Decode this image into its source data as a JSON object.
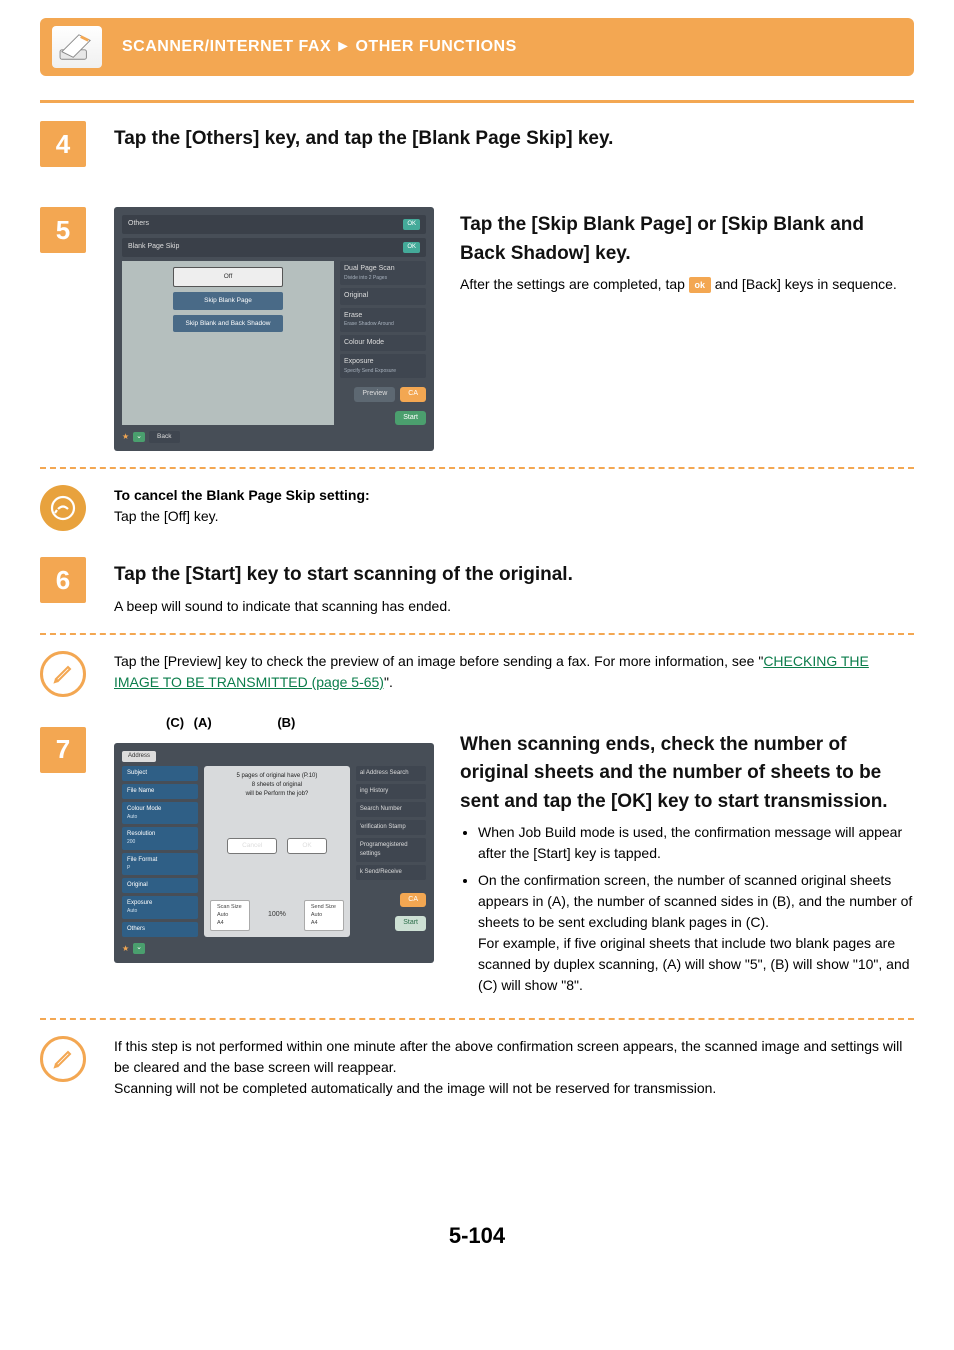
{
  "breadcrumb": {
    "section": "SCANNER/INTERNET FAX",
    "subsection": "OTHER FUNCTIONS"
  },
  "page_number": "5-104",
  "steps": {
    "s4": {
      "num": "4",
      "title": "Tap the [Others] key, and tap the [Blank Page Skip] key."
    },
    "s5": {
      "num": "5",
      "title": "Tap the [Skip Blank Page] or [Skip Blank and Back Shadow] key.",
      "text_before": "After the settings are completed, tap ",
      "ok": "ok",
      "text_after": " and [Back] keys in sequence.",
      "panel": {
        "tabs": {
          "others": "Others",
          "blank": "Blank Page Skip",
          "ok": "OK"
        },
        "opts": {
          "off": "Off",
          "skipblank": "Skip Blank Page",
          "skipboth": "Skip Blank and Back Shadow"
        },
        "side": {
          "dual": {
            "t": "Dual Page Scan",
            "s": "Divide into 2 Pages"
          },
          "original": "Original",
          "erase": {
            "t": "Erase",
            "s": "Erase Shadow Around"
          },
          "colourmode": "Colour Mode",
          "exposure": {
            "t": "Exposure",
            "s": "Specify Send Exposure"
          }
        },
        "footer": {
          "preview": "Preview",
          "ca": "CA",
          "start": "Start",
          "back": "Back"
        }
      }
    },
    "cancel_note": {
      "title": "To cancel the Blank Page Skip setting:",
      "text": "Tap the [Off] key."
    },
    "s6": {
      "num": "6",
      "title": "Tap the [Start] key to start scanning of the original.",
      "text": "A beep will sound to indicate that scanning has ended."
    },
    "preview_note": {
      "text_before": "Tap the [Preview] key to check the preview of an image before sending a fax. For more information, see \"",
      "link": "CHECKING THE IMAGE TO BE TRANSMITTED (page 5-65)",
      "text_after": "\"."
    },
    "s7": {
      "num": "7",
      "callout_c": "(C)",
      "callout_a": "(A)",
      "callout_b": "(B)",
      "title": "When scanning ends, check the number of original sheets and the number of sheets to be sent and tap the [OK] key to start transmission.",
      "b1": "When Job Build mode is used, the confirmation message will appear after the [Start] key is tapped.",
      "b2": "On the confirmation screen, the number of scanned original sheets appears in (A), the number of scanned sides in (B), and the number of sheets to be sent excluding blank pages in (C).",
      "b2_extra": "For example, if five original sheets that include two blank pages are scanned by duplex scanning, (A) will show \"5\", (B) will show \"10\", and (C) will show \"8\".",
      "panel": {
        "address": "Address",
        "msg_l1": "5 pages of original have (P.10)",
        "msg_l2": "8 sheets of original",
        "msg_l3": "will be Perform the job?",
        "btn_cancel": "Cancel",
        "btn_ok": "OK",
        "scan_size": "Scan Size",
        "send_size": "Send Size",
        "pct": "100%",
        "auto": "Auto",
        "a4": "A4",
        "sidebar": {
          "subject": "Subject",
          "filename": "File Name",
          "colormode": {
            "t": "Colour Mode",
            "s": "Auto"
          },
          "resolution": {
            "t": "Resolution",
            "s": "200"
          },
          "fileformat": {
            "t": "File Format",
            "s": "P"
          },
          "original": "Original",
          "exposure": {
            "t": "Exposure",
            "s": "Auto"
          },
          "others": "Others"
        },
        "right": {
          "gsearch": "al Address Search",
          "history": "ing History",
          "search": "Search Number",
          "stamp": "'erification Stamp",
          "program": {
            "t": "Program",
            "s": "egistered settings"
          },
          "sendrecv": "k Send/Receive"
        },
        "ca": "CA",
        "start": "Start"
      }
    },
    "timeout_note": {
      "line1": "If this step is not performed within one minute after the above confirmation screen appears, the scanned image and settings will be cleared and the base screen will reappear.",
      "line2": "Scanning will not be completed automatically and the image will not be reserved for transmission."
    }
  }
}
